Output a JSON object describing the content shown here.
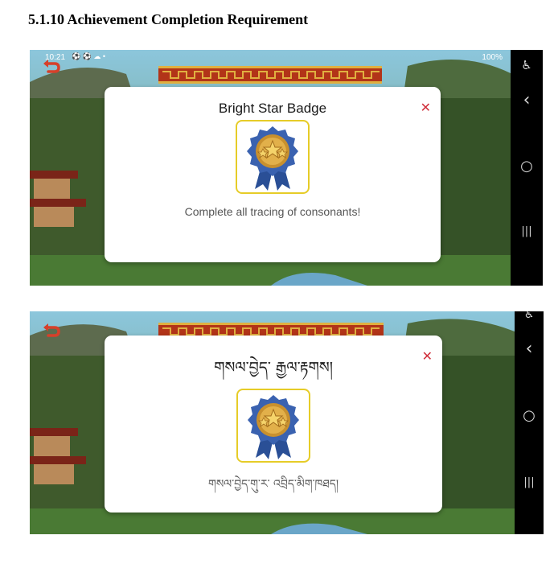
{
  "document": {
    "heading": "5.1.10 Achievement Completion Requirement"
  },
  "screenshot_english": {
    "status_bar": {
      "time": "10:21",
      "notification_icons": "⚽ ⚽ ☁ •",
      "battery": "100%"
    },
    "modal": {
      "title": "Bright Star Badge",
      "description": "Complete all tracing of consonants!",
      "close_symbol": "✕"
    }
  },
  "screenshot_tibetan": {
    "modal": {
      "title": "གསལ་བྱེད་ རྒྱལ་རྟགས།",
      "description": "གསལ་བྱེད་གུ་ར་ འབྲིད་མིག་ཁཐད།",
      "close_symbol": "✕"
    }
  },
  "navbar": {
    "accessibility_icon": "♿",
    "back_icon": "‹",
    "home_icon": "○",
    "recents_icon": "|||"
  },
  "colors": {
    "close": "#d0303c",
    "badge_frame": "#e6cc28",
    "back_button": "#d6402a",
    "navbar": "#000000"
  }
}
